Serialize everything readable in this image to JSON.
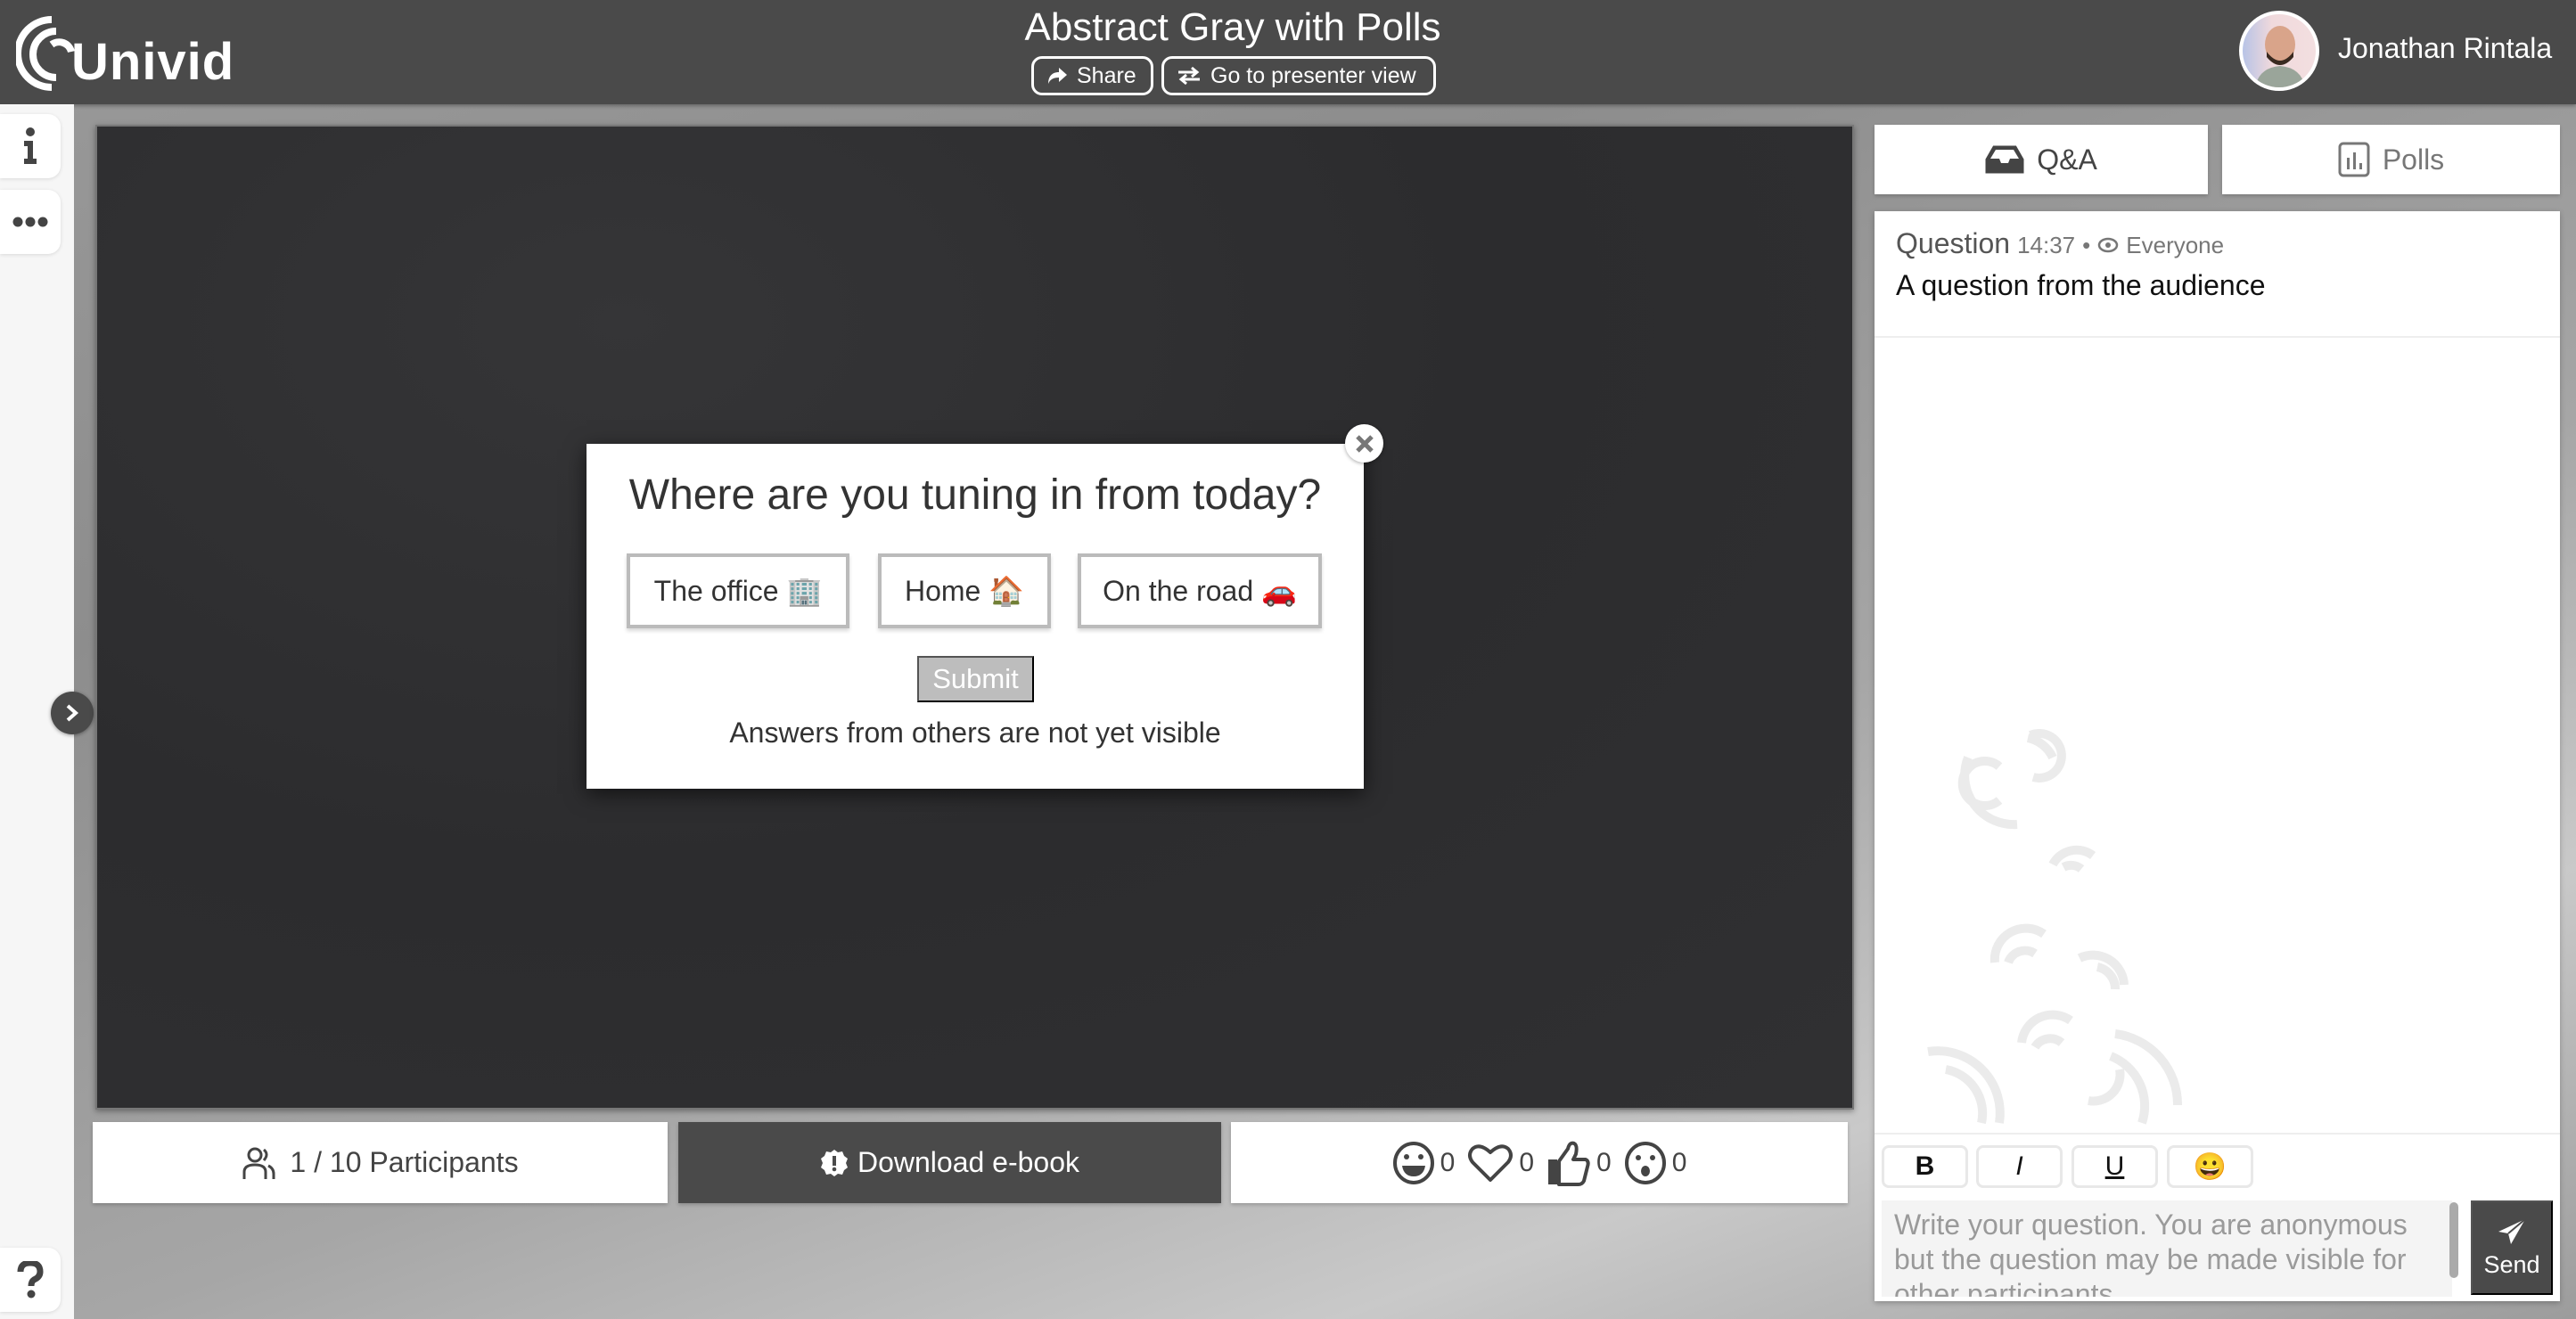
{
  "header": {
    "logo_text": "Univid",
    "title": "Abstract Gray with Polls",
    "share_label": "Share",
    "presenter_label": "Go to presenter view",
    "user_name": "Jonathan Rintala"
  },
  "sidebar": {
    "items": [
      {
        "name": "info",
        "icon": "info-icon"
      },
      {
        "name": "more",
        "icon": "ellipsis-icon"
      },
      {
        "name": "help",
        "icon": "question-icon"
      }
    ],
    "expand_icon": "chevron-right-icon"
  },
  "poll": {
    "question": "Where are you tuning in from today?",
    "options": [
      {
        "label": "The office",
        "emoji": "🏢"
      },
      {
        "label": "Home",
        "emoji": "🏠"
      },
      {
        "label": "On the road",
        "emoji": "🚗"
      }
    ],
    "submit_label": "Submit",
    "note": "Answers from others are not yet visible"
  },
  "bottom_bar": {
    "participants": "1 / 10 Participants",
    "download_label": "Download e-book",
    "reactions": [
      {
        "name": "laugh",
        "count": "0"
      },
      {
        "name": "heart",
        "count": "0"
      },
      {
        "name": "thumbs-up",
        "count": "0"
      },
      {
        "name": "surprised",
        "count": "0"
      }
    ]
  },
  "right_panel": {
    "tabs": [
      {
        "label": "Q&A",
        "icon": "inbox-icon",
        "active": true
      },
      {
        "label": "Polls",
        "icon": "poll-chart-icon",
        "active": false
      }
    ],
    "questions": [
      {
        "label": "Question",
        "time": "14:37",
        "separator": "•",
        "visibility": "Everyone",
        "text": "A question from the audience"
      }
    ],
    "format_buttons": [
      "B",
      "I",
      "U",
      "😀"
    ],
    "input_placeholder": "Write your question. You are anonymous but the question may be made visible for other participants",
    "send_label": "Send"
  }
}
